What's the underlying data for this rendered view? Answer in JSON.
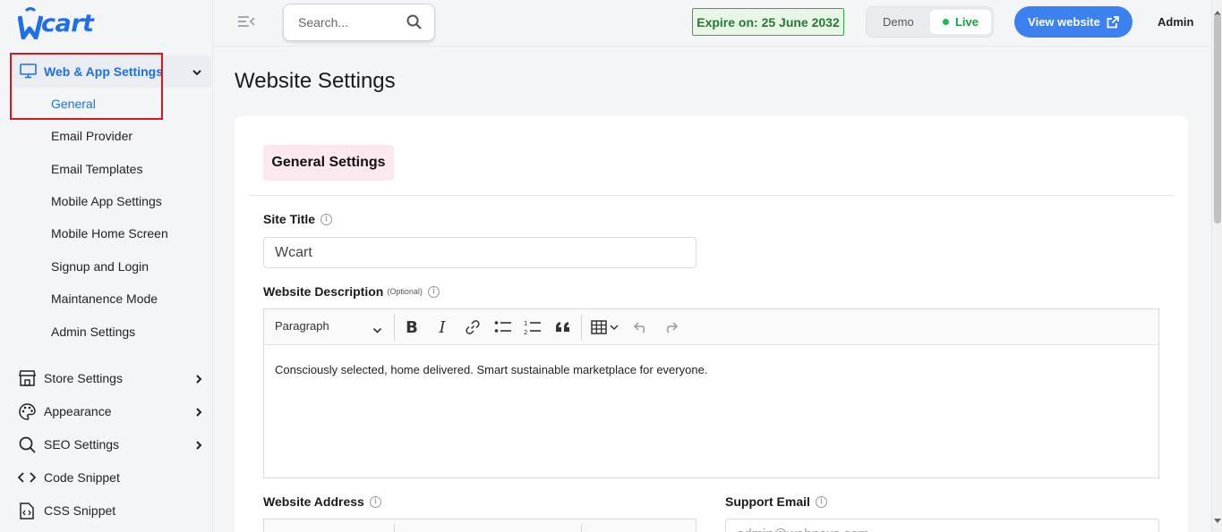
{
  "brand": {
    "logo_text": "cart",
    "logo_letter": "W"
  },
  "sidebar": {
    "active_section": {
      "label": "Web & App Settings",
      "icon": "monitor-icon"
    },
    "subitems": [
      {
        "label": "General",
        "current": true
      },
      {
        "label": "Email Provider"
      },
      {
        "label": "Email Templates"
      },
      {
        "label": "Mobile App Settings"
      },
      {
        "label": "Mobile Home Screen"
      },
      {
        "label": "Signup and Login"
      },
      {
        "label": "Maintanence Mode"
      },
      {
        "label": "Admin Settings"
      }
    ],
    "sections": [
      {
        "label": "Store Settings",
        "icon": "store-icon",
        "has_children": true
      },
      {
        "label": "Appearance",
        "icon": "palette-icon",
        "has_children": true
      },
      {
        "label": "SEO Settings",
        "icon": "search-icon",
        "has_children": true
      },
      {
        "label": "Code Snippet",
        "icon": "code-icon",
        "has_children": false
      },
      {
        "label": "CSS Snippet",
        "icon": "file-code-icon",
        "has_children": false
      }
    ]
  },
  "topbar": {
    "search_placeholder": "Search...",
    "expire_text": "Expire on: 25 June 2032",
    "mode_demo": "Demo",
    "mode_live": "Live",
    "view_website": "View website",
    "user": "Admin"
  },
  "main": {
    "page_title": "Website Settings",
    "tab": "General Settings",
    "site_title_label": "Site Title",
    "site_title_value": "Wcart",
    "description_label": "Website Description",
    "optional_text": "(Optional)",
    "editor_block_style": "Paragraph",
    "description_value": "Consciously selected, home delivered. Smart sustainable marketplace for everyone.",
    "address_label": "Website Address",
    "support_email_label": "Support Email",
    "support_email_value": "admin@webnexs.com"
  },
  "colors": {
    "accent": "#1e6fe8",
    "highlight_box": "#e0141e",
    "live": "#1fb55a",
    "expire_border": "#3aa84a"
  }
}
